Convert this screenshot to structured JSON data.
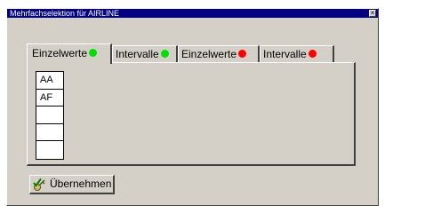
{
  "window": {
    "title": "Mehrfachselektion für AIRLINE",
    "close_glyph": "×"
  },
  "tabs": [
    {
      "label": "Einzelwerte",
      "dot_color": "#00e000",
      "active": true
    },
    {
      "label": "Intervalle",
      "dot_color": "#00e000",
      "active": false
    },
    {
      "label": "Einzelwerte",
      "dot_color": "#ff0000",
      "active": false
    },
    {
      "label": "Intervalle",
      "dot_color": "#ff0000",
      "active": false
    }
  ],
  "values_list": [
    "AA",
    "AF",
    "",
    "",
    ""
  ],
  "apply_button": {
    "label": "Übernehmen",
    "icon": "check-key-icon"
  }
}
